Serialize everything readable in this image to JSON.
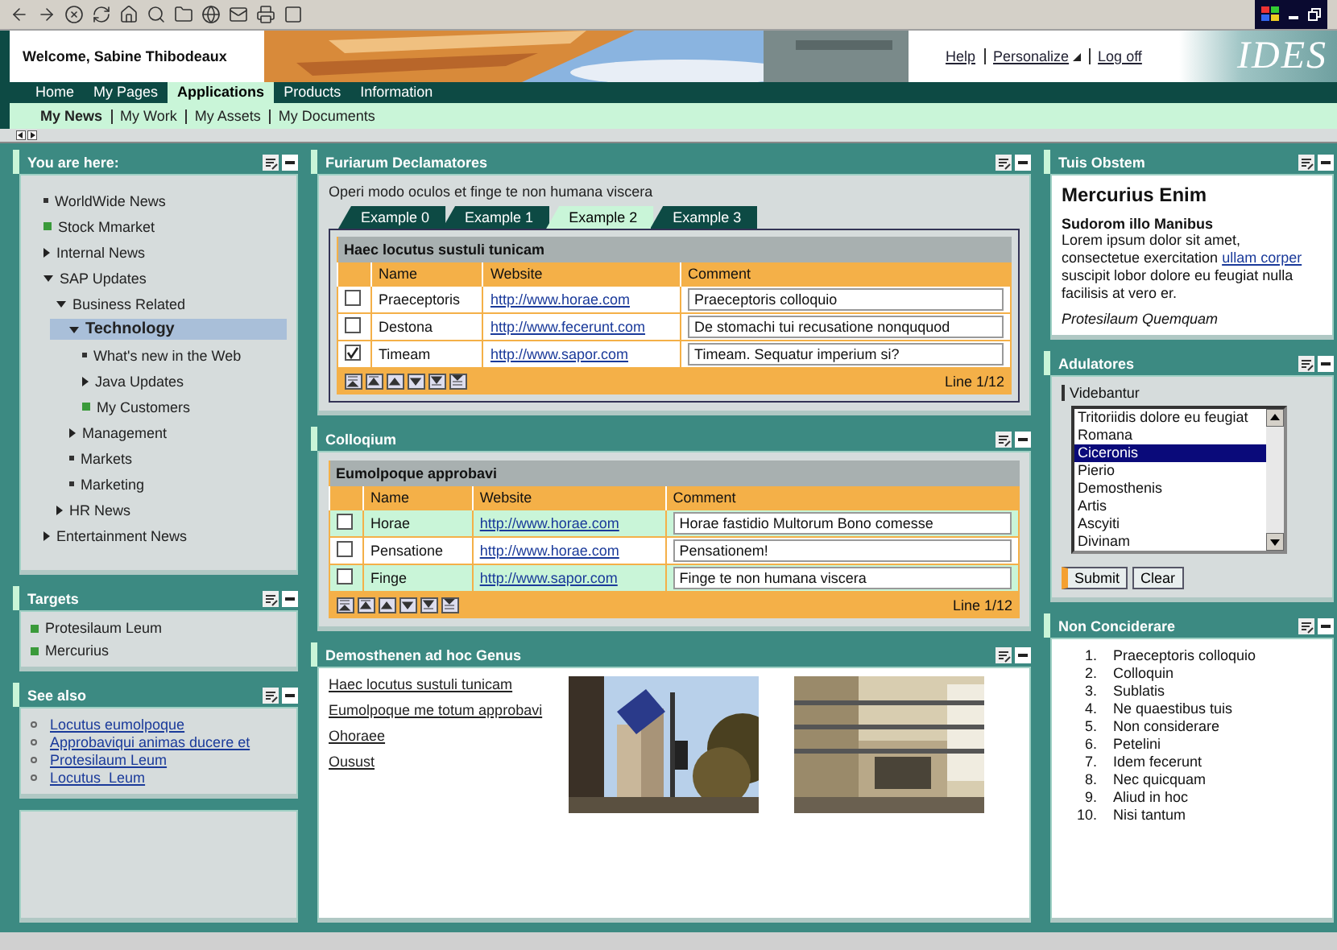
{
  "header": {
    "welcome": "Welcome, Sabine Thibodeaux",
    "links": [
      "Help",
      "Personalize",
      "Log off"
    ],
    "logo": "IDES"
  },
  "nav": [
    {
      "label": "Home",
      "selected": false
    },
    {
      "label": "My Pages",
      "selected": false
    },
    {
      "label": "Applications",
      "selected": true
    },
    {
      "label": "Products",
      "selected": false
    },
    {
      "label": "Information",
      "selected": false
    }
  ],
  "subnav": [
    {
      "label": "My News",
      "selected": true
    },
    {
      "label": "My Work",
      "selected": false
    },
    {
      "label": "My Assets",
      "selected": false
    },
    {
      "label": "My Documents",
      "selected": false
    }
  ],
  "you_are_here": {
    "title": "You are here:",
    "tree": [
      {
        "label": "WorldWide News",
        "kind": "leaf",
        "selected": false
      },
      {
        "label": "Stock Mmarket",
        "kind": "marked",
        "selected": false
      },
      {
        "label": "Internal News",
        "kind": "folder",
        "expanded": false,
        "selected": false
      },
      {
        "label": "SAP Updates",
        "kind": "folder",
        "expanded": true,
        "selected": false,
        "children": [
          {
            "label": "Business Related",
            "kind": "folder",
            "expanded": true,
            "selected": false,
            "children": [
              {
                "label": "Technology",
                "kind": "folder",
                "expanded": true,
                "selected": true,
                "children": [
                  {
                    "label": "What's new in the Web",
                    "kind": "leaf",
                    "selected": false
                  },
                  {
                    "label": "Java Updates",
                    "kind": "folder",
                    "expanded": false,
                    "selected": false
                  },
                  {
                    "label": "My Customers",
                    "kind": "marked",
                    "selected": false
                  }
                ]
              },
              {
                "label": "Management",
                "kind": "folder",
                "expanded": false,
                "selected": false
              },
              {
                "label": "Markets",
                "kind": "leaf",
                "selected": false
              },
              {
                "label": "Marketing",
                "kind": "leaf",
                "selected": false
              }
            ]
          },
          {
            "label": "HR News",
            "kind": "folder",
            "expanded": false,
            "selected": false
          }
        ]
      },
      {
        "label": "Entertainment News",
        "kind": "folder",
        "expanded": false,
        "selected": false
      }
    ]
  },
  "targets": {
    "title": "Targets",
    "items": [
      "Protesilaum Leum",
      "Mercurius"
    ]
  },
  "see_also": {
    "title": "See also",
    "links": [
      "Locutus eumolpoque",
      "Approbaviqui animas ducere et",
      "Protesilaum Leum",
      "Locutus  Leum"
    ]
  },
  "furiarum": {
    "title": "Furiarum Declamatores",
    "intro": "Operi modo oculos et finge te non humana viscera",
    "tabs": [
      {
        "label": "Example 0",
        "selected": false
      },
      {
        "label": "Example 1",
        "selected": false
      },
      {
        "label": "Example 2",
        "selected": true
      },
      {
        "label": "Example 3",
        "selected": false
      }
    ],
    "table": {
      "caption": "Haec locutus sustuli tunicam",
      "striped": false,
      "columns": [
        "Name",
        "Website",
        "Comment"
      ],
      "rows": [
        {
          "checked": false,
          "name": "Praeceptoris",
          "website": "http://www.horae.com",
          "comment": "Praeceptoris colloquio"
        },
        {
          "checked": false,
          "name": "Destona",
          "website": "http://www.fecerunt.com",
          "comment": "De stomachi tui recusatione nonququod"
        },
        {
          "checked": true,
          "name": "Timeam",
          "website": "http://www.sapor.com",
          "comment": "Timeam. Sequatur imperium si?"
        }
      ],
      "footer": "Line 1/12"
    }
  },
  "colloqium": {
    "title": "Colloqium",
    "table": {
      "caption": "Eumolpoque approbavi",
      "striped": true,
      "columns": [
        "Name",
        "Website",
        "Comment"
      ],
      "rows": [
        {
          "checked": false,
          "name": "Horae",
          "website": "http://www.horae.com",
          "comment": "Horae fastidio Multorum Bono comesse"
        },
        {
          "checked": false,
          "name": "Pensatione",
          "website": "http://www.horae.com",
          "comment": "Pensationem!"
        },
        {
          "checked": false,
          "name": "Finge",
          "website": "http://www.sapor.com",
          "comment": "Finge te non humana viscera"
        }
      ],
      "footer": "Line 1/12"
    }
  },
  "demosthenen": {
    "title": "Demosthenen ad hoc Genus",
    "links": [
      "Haec locutus sustuli tunicam",
      "Eumolpoque me totum approbavi",
      "Ohoraee",
      "Ousust"
    ],
    "pictures": [
      {
        "kind": "picture"
      },
      {
        "kind": "picture"
      }
    ]
  },
  "tuis_obstem": {
    "title": "Tuis Obstem",
    "heading": "Mercurius Enim",
    "subheading": "Sudorom illo Manibus",
    "text_before": "Lorem ipsum dolor sit amet, consectetue exercitation ",
    "link": "ullam corper",
    "text_after": " suscipit lobor dolore eu feugiat nulla facilisis at vero er.",
    "signature": "Protesilaum Quemquam"
  },
  "adulatores": {
    "title": "Adulatores",
    "label": "Videbantur",
    "options": [
      {
        "text": "Tritoriidis dolore eu feugiat",
        "selected": false
      },
      {
        "text": "Romana",
        "selected": false
      },
      {
        "text": "Ciceronis",
        "selected": true
      },
      {
        "text": "Pierio",
        "selected": false
      },
      {
        "text": "Demosthenis",
        "selected": false
      },
      {
        "text": "Artis",
        "selected": false
      },
      {
        "text": "Ascyiti",
        "selected": false
      },
      {
        "text": "Divinam",
        "selected": false
      }
    ],
    "buttons": [
      {
        "label": "Submit",
        "kind": "primary"
      },
      {
        "label": "Clear",
        "kind": "secondary"
      }
    ]
  },
  "non_conciderare": {
    "title": "Non Conciderare",
    "items": [
      {
        "number": "1.",
        "text": "Praeceptoris colloquio"
      },
      {
        "number": "2.",
        "text": "Colloquin"
      },
      {
        "number": "3.",
        "text": "Sublatis"
      },
      {
        "number": "4.",
        "text": "Ne quaestibus tuis"
      },
      {
        "number": "5.",
        "text": "Non considerare"
      },
      {
        "number": "6.",
        "text": "Petelini"
      },
      {
        "number": "7.",
        "text": "Idem fecerunt"
      },
      {
        "number": "8.",
        "text": "Nec quicquam"
      },
      {
        "number": "9.",
        "text": "Aliud in hoc"
      },
      {
        "number": "10.",
        "text": "Nisi tantum"
      }
    ]
  }
}
